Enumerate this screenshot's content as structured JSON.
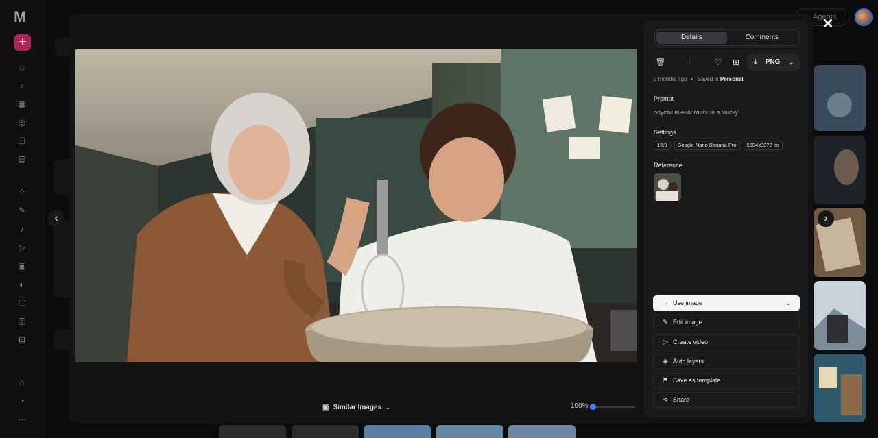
{
  "rail": {
    "logo": "M",
    "new_button": "+",
    "icons": [
      "home-icon",
      "search-icon",
      "grid-icon",
      "globe-icon",
      "layers-icon",
      "book-icon",
      "apps-icon",
      "brush-icon",
      "mic-icon",
      "video-icon",
      "image-icon",
      "palette-icon",
      "frame-icon",
      "camera-icon",
      "crop-icon",
      "school-icon",
      "bell-icon",
      "more-icon"
    ]
  },
  "header": {
    "agents_label": "Agents"
  },
  "viewer": {
    "similar_label": "Similar Images",
    "zoom_label": "100%",
    "zoom_level": 0.0
  },
  "panel": {
    "tabs": [
      {
        "label": "Details",
        "active": true
      },
      {
        "label": "Comments",
        "active": false
      }
    ],
    "download_format": "PNG",
    "meta": {
      "age": "2 months ago",
      "saved_prefix": "Saved in",
      "saved_location": "Personal"
    },
    "prompt_label": "Prompt",
    "prompt_text": "опусти вінчик глибше в миску",
    "settings_label": "Settings",
    "settings_chips": [
      "16:9",
      "Google Nano Banana Pro",
      "5504x3072 px"
    ],
    "reference_label": "Reference",
    "actions": [
      {
        "label": "Use image",
        "icon": "arrow-right-icon",
        "primary": true
      },
      {
        "label": "Edit image",
        "icon": "edit-image-icon",
        "primary": false
      },
      {
        "label": "Create video",
        "icon": "video-icon",
        "primary": false
      },
      {
        "label": "Auto layers",
        "icon": "layers-icon",
        "primary": false
      },
      {
        "label": "Save as template",
        "icon": "bookmark-icon",
        "primary": false
      },
      {
        "label": "Share",
        "icon": "share-icon",
        "primary": false
      }
    ]
  },
  "colors": {
    "accent": "#3d82f7",
    "brand": "#b0245c",
    "panel_bg": "#1a1a1c"
  }
}
